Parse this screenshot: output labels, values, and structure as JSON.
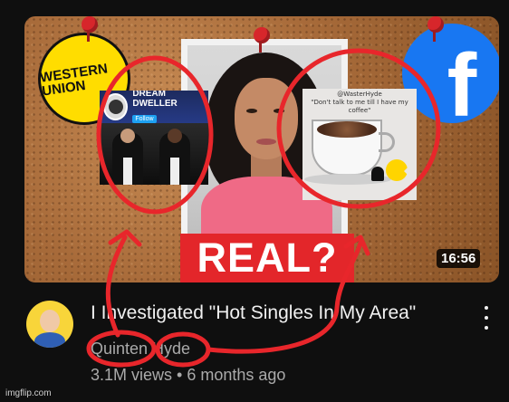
{
  "video": {
    "title": "I Investigated \"Hot Singles In My Area\"",
    "channel": "Quinten Hyde",
    "views": "3.1M views",
    "separator": "•",
    "age": "6 months ago",
    "duration": "16:56"
  },
  "thumbnail": {
    "banner_text": "REAL?",
    "western_union_label": "WESTERN UNION",
    "facebook_glyph": "f"
  },
  "overlays": {
    "dream_dweller": {
      "title": "DREAM DWELLER",
      "follow_label": "Follow"
    },
    "coffee": {
      "handle": "@WasterHyde",
      "quote": "\"Don't talk to me till I have my coffee\""
    }
  },
  "annotations": {
    "color": "#e8262b"
  },
  "watermark": "imgflip.com"
}
